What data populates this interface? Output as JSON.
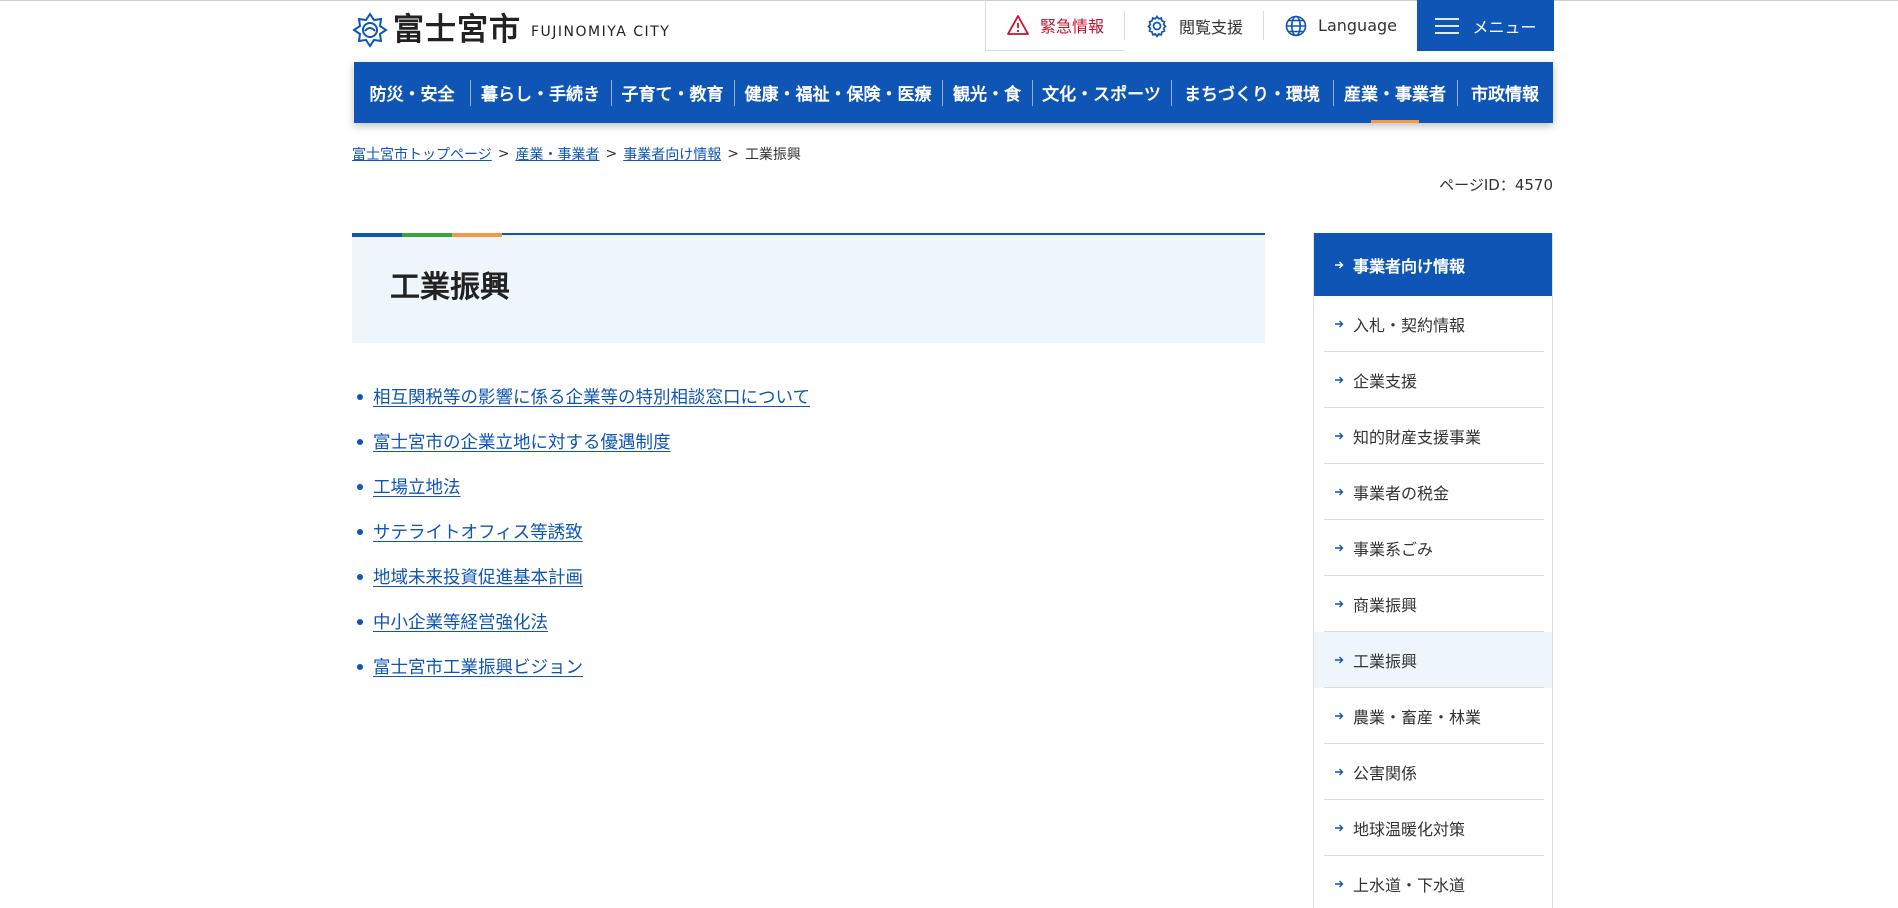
{
  "header": {
    "logo_ja": "富士宮市",
    "logo_en": "FUJINOMIYA CITY",
    "emergency": "緊急情報",
    "accessibility": "閲覧支援",
    "language": "Language",
    "menu": "メニュー"
  },
  "gnav": [
    {
      "label": "防災・安全"
    },
    {
      "label": "暮らし・手続き"
    },
    {
      "label": "子育て・教育"
    },
    {
      "label": "健康・福祉・保険・医療"
    },
    {
      "label": "観光・食"
    },
    {
      "label": "文化・スポーツ"
    },
    {
      "label": "まちづくり・環境"
    },
    {
      "label": "産業・事業者"
    },
    {
      "label": "市政情報"
    }
  ],
  "breadcrumb": {
    "items": [
      "富士宮市トップページ",
      "産業・事業者",
      "事業者向け情報"
    ],
    "separator": ">",
    "current": "工業振興"
  },
  "page_id": "ページID：4570",
  "title": "工業振興",
  "links": [
    "相互関税等の影響に係る企業等の特別相談窓口について",
    "富士宮市の企業立地に対する優遇制度",
    "工場立地法",
    "サテライトオフィス等誘致",
    "地域未来投資促進基本計画",
    "中小企業等経営強化法",
    "富士宮市工業振興ビジョン"
  ],
  "side": {
    "heading": "事業者向け情報",
    "items": [
      "入札・契約情報",
      "企業支援",
      "知的財産支援事業",
      "事業者の税金",
      "事業系ごみ",
      "商業振興",
      "工業振興",
      "農業・畜産・林業",
      "公害関係",
      "地球温暖化対策",
      "上水道・下水道"
    ]
  },
  "colors": {
    "brand_blue": "#0f55b5",
    "emergency_red": "#c8102e",
    "accent_orange": "#f29a4a",
    "accent_green": "#3ea33a",
    "light_bg": "#eef6fc"
  }
}
